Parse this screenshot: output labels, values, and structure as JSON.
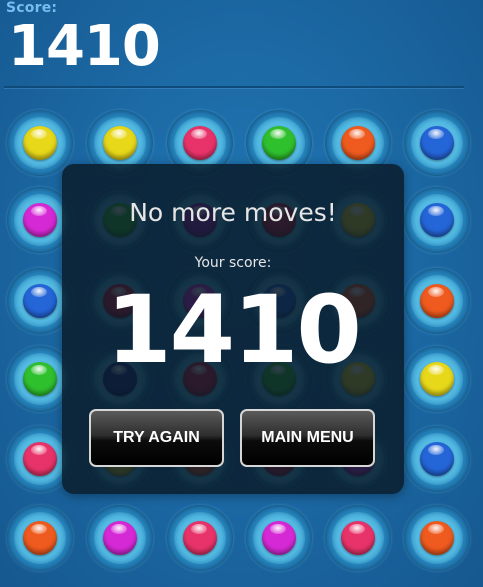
{
  "header": {
    "score_label": "Score:",
    "score_value": "1410"
  },
  "board": {
    "columns": 6,
    "rows": 6,
    "cells": [
      [
        "yellow",
        "yellow",
        "pink",
        "green",
        "orange",
        "blue"
      ],
      [
        "magenta",
        "green",
        "purple",
        "red",
        "yellow",
        "blue"
      ],
      [
        "blue",
        "red",
        "magenta",
        "blue",
        "orange",
        "orange"
      ],
      [
        "green",
        "navy",
        "red",
        "green",
        "yellow",
        "yellow"
      ],
      [
        "pink",
        "yellow",
        "orange",
        "red",
        "magenta",
        "blue"
      ],
      [
        "orange",
        "magenta",
        "pink",
        "magenta",
        "pink",
        "orange"
      ]
    ],
    "colors": {
      "yellow": "#e8d81a",
      "pink": "#e8336a",
      "green": "#2fc02e",
      "orange": "#ef5a1e",
      "blue": "#2465d8",
      "magenta": "#d629d6",
      "purple": "#9a1fb2",
      "red": "#d01a3a",
      "navy": "#1f2f8c"
    }
  },
  "dialog": {
    "title": "No more moves!",
    "your_score_label": "Your score:",
    "final_score": "1410",
    "try_again_label": "TRY AGAIN",
    "main_menu_label": "MAIN MENU"
  }
}
